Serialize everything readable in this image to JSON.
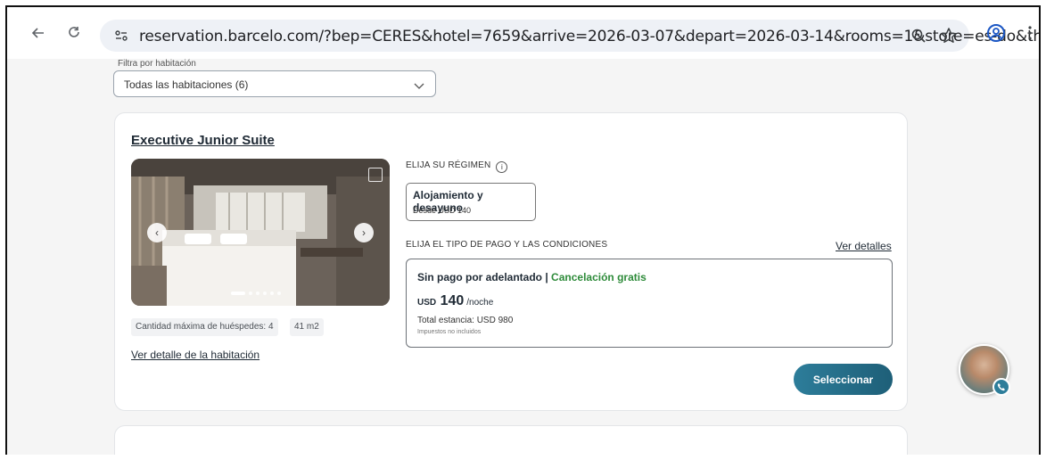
{
  "browser": {
    "url": "reservation.barcelo.com/?bep=CERES&hotel=7659&arrive=2026-03-07&depart=2026-03-14&rooms=1&store=es-do&the...",
    "icons": [
      "back-arrow-icon",
      "reload-icon",
      "site-settings-icon",
      "zoom-icon",
      "bookmark-star-icon",
      "profile-icon",
      "menu-dots-icon"
    ]
  },
  "filter": {
    "label": "Filtra por habitación",
    "value": "Todas las habitaciones (6)"
  },
  "room": {
    "title": "Executive Junior Suite",
    "max_guests": "Cantidad máxima de huéspedes: 4",
    "size": "41 m2",
    "detail_link": "Ver detalle de la habitación",
    "gallery": {
      "total_photos": 6,
      "current_photo": 1
    }
  },
  "regimen": {
    "section_label": "ELIJA SU RÉGIMEN",
    "info_icon": "i",
    "option_name": "Alojamiento y desayuno",
    "option_price": "Desde USD 140"
  },
  "payment": {
    "section_label": "ELIJA EL TIPO DE PAGO Y LAS CONDICIONES",
    "details_link": "Ver detalles",
    "title_part1": "Sin pago por adelantado | ",
    "title_part2": "Cancelación gratis",
    "currency": "USD",
    "amount": "140",
    "per_night": "/noche",
    "total": "Total estancia: USD 980",
    "taxes": "Impuestos no incluidos"
  },
  "actions": {
    "select_label": "Seleccionar"
  },
  "colors": {
    "accent": "#2d7d9a",
    "green": "#2e8b3a",
    "text": "#1f2a35"
  }
}
